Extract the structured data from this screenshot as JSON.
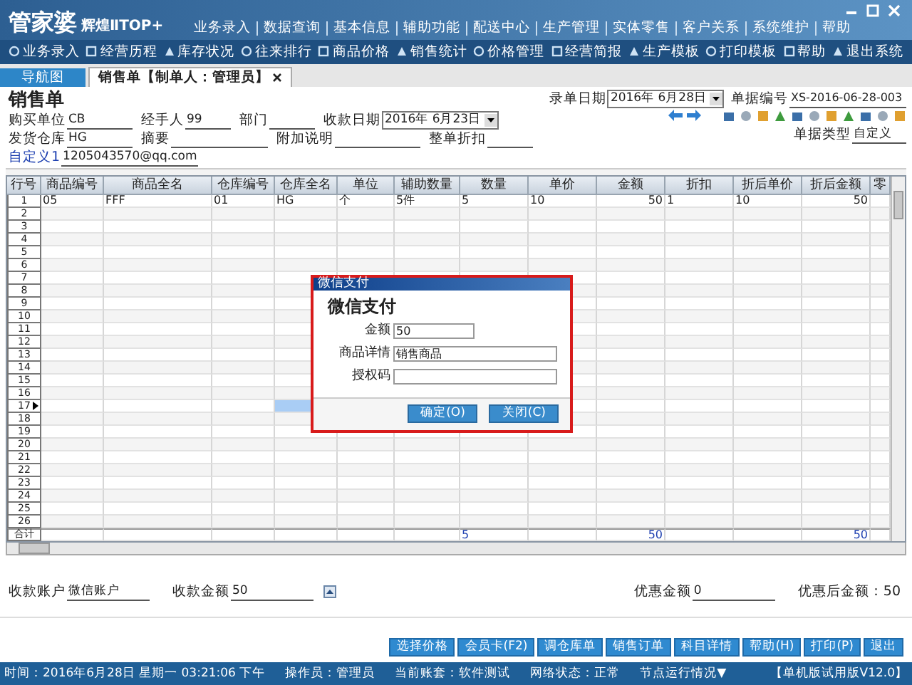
{
  "app": {
    "logo": "管家婆",
    "edition": "辉煌ⅡTOP+"
  },
  "menu": [
    "业务录入",
    "数据查询",
    "基本信息",
    "辅助功能",
    "配送中心",
    "生产管理",
    "实体零售",
    "客户关系",
    "系统维护",
    "帮助"
  ],
  "toolbar": [
    "业务录入",
    "经营历程",
    "库存状况",
    "往来排行",
    "商品价格",
    "销售统计",
    "价格管理",
    "经营简报",
    "生产模板",
    "打印模板",
    "帮助",
    "退出系统"
  ],
  "tabs": [
    {
      "label": "导航图",
      "selected": false,
      "closable": false
    },
    {
      "label": "销售单【制单人：管理员】",
      "selected": true,
      "closable": true
    }
  ],
  "form": {
    "title": "销售单",
    "row1": [
      {
        "label": "购买单位",
        "value": "CB",
        "kind": "text"
      },
      {
        "label": "经手人",
        "value": "99",
        "kind": "text"
      },
      {
        "label": "部门",
        "kind": "text"
      },
      {
        "label": "收款日期",
        "value": "2016年 6月23日",
        "kind": "date"
      }
    ],
    "row2": [
      {
        "label": "发货仓库",
        "value": "HG",
        "kind": "text"
      },
      {
        "label": "摘要",
        "kind": "text"
      },
      {
        "label": "附加说明",
        "kind": "text"
      },
      {
        "label": "整单折扣",
        "kind": "text"
      }
    ],
    "custom": {
      "label": "自定义1",
      "value": "1205043570@qq.com"
    },
    "record_date": {
      "label": "录单日期",
      "value": "2016年 6月28日"
    },
    "doc_no": {
      "label": "单据编号",
      "value": "XS-2016-06-28-003"
    },
    "doc_type": {
      "label": "单据类型",
      "value": "自定义"
    }
  },
  "table": {
    "columns": [
      "行号",
      "商品编号",
      "商品全名",
      "仓库编号",
      "仓库全名",
      "单位",
      "辅助数量",
      "数量",
      "单价",
      "金额",
      "折扣",
      "折后单价",
      "折后金额",
      "零"
    ],
    "rows": [
      {
        "no": "1",
        "current": false,
        "cells": [
          "05",
          "FFF",
          "01",
          "HG",
          "个",
          "5件",
          "5",
          "10",
          "50",
          "1",
          "10",
          "50"
        ]
      },
      {
        "no": "2",
        "current": false
      },
      {
        "no": "3",
        "current": false
      },
      {
        "no": "4",
        "current": false
      },
      {
        "no": "5",
        "current": false
      },
      {
        "no": "6",
        "current": false
      },
      {
        "no": "7",
        "current": false
      },
      {
        "no": "8",
        "current": false
      },
      {
        "no": "9",
        "current": false
      },
      {
        "no": "10",
        "current": false
      },
      {
        "no": "11",
        "current": false
      },
      {
        "no": "12",
        "current": false
      },
      {
        "no": "13",
        "current": false
      },
      {
        "no": "14",
        "current": false
      },
      {
        "no": "15",
        "current": false
      },
      {
        "no": "16",
        "current": false
      },
      {
        "no": "17",
        "current": true
      },
      {
        "no": "18",
        "current": false
      },
      {
        "no": "19",
        "current": false
      },
      {
        "no": "20",
        "current": false
      },
      {
        "no": "21",
        "current": false
      },
      {
        "no": "22",
        "current": false
      },
      {
        "no": "23",
        "current": false
      },
      {
        "no": "24",
        "current": false
      },
      {
        "no": "25",
        "current": false
      },
      {
        "no": "26",
        "current": false
      }
    ],
    "totals": {
      "label": "合计",
      "quantity": "5",
      "amount": "50",
      "discounted_amount": "50"
    }
  },
  "dialog": {
    "title": "微信支付",
    "heading": "微信支付",
    "amount": {
      "label": "金额",
      "value": "50"
    },
    "detail": {
      "label": "商品详情",
      "value": "销售商品"
    },
    "auth": {
      "label": "授权码"
    },
    "buttons": [
      "确定(O)",
      "关闭(C)"
    ]
  },
  "payment": {
    "account": {
      "label": "收款账户",
      "value": "微信账户"
    },
    "received": {
      "label": "收款金额",
      "value": "50"
    },
    "discount": {
      "label": "优惠金额",
      "value": "0"
    },
    "after_discount": "优惠后金额：50"
  },
  "actions": [
    "选择价格",
    "会员卡(F2)",
    "调仓库单",
    "销售订单",
    "科目详情",
    "帮助(H)",
    "打印(P)",
    "退出"
  ],
  "status_bar": [
    "时间：2016年6月28日 星期一 03:21:06 下午",
    "操作员：管理员",
    "当前账套：软件测试",
    "网络状态：正常",
    "节点运行情况▼",
    "【单机版试用版V12.0】"
  ]
}
